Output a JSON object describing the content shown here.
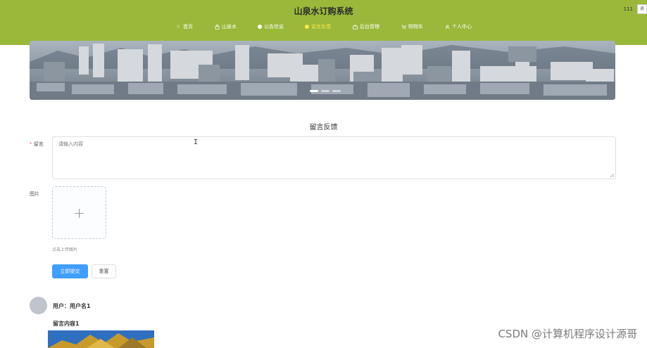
{
  "header": {
    "site_title": "山泉水订购系统",
    "user_name": "111",
    "logout_label": "退",
    "colors": {
      "header_bg": "#9ab83a",
      "nav_active": "#f6e84a"
    }
  },
  "nav": {
    "items": [
      {
        "label": "首页",
        "icon": "star-icon"
      },
      {
        "label": "山泉水",
        "icon": "bag-icon"
      },
      {
        "label": "公告信息",
        "icon": "dot-icon"
      },
      {
        "label": "留言反馈",
        "icon": "dot-icon",
        "active": true
      },
      {
        "label": "后台管理",
        "icon": "briefcase-icon"
      },
      {
        "label": "购物车",
        "icon": "cart-icon"
      },
      {
        "label": "个人中心",
        "icon": "user-icon"
      }
    ]
  },
  "form": {
    "title": "留言反馈",
    "message_label": "留言",
    "message_required_mark": "*",
    "message_placeholder": "请输入内容",
    "image_label": "图片",
    "upload_plus": "+",
    "upload_tip": "点击上传图片",
    "submit_label": "立即提交",
    "reset_label": "重置",
    "colors": {
      "primary": "#409eff"
    }
  },
  "comments": [
    {
      "user": "用户：用户名1",
      "content": "留言内容1"
    }
  ],
  "watermark": "CSDN @计算机程序设计源哥"
}
